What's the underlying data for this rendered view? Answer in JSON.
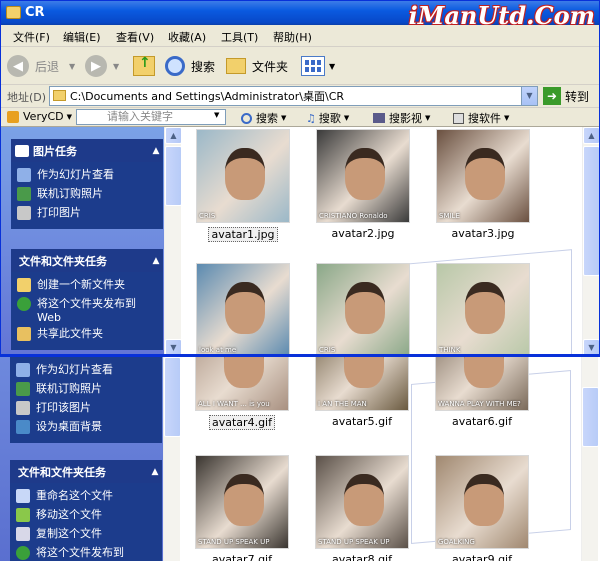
{
  "window": {
    "title": "CR",
    "brand": "iManUtd.Com"
  },
  "menu": [
    {
      "label": "文件(F)"
    },
    {
      "label": "编辑(E)"
    },
    {
      "label": "查看(V)"
    },
    {
      "label": "收藏(A)"
    },
    {
      "label": "工具(T)"
    },
    {
      "label": "帮助(H)"
    }
  ],
  "toolbar": {
    "back": "后退",
    "search": "搜索",
    "folders": "文件夹"
  },
  "address": {
    "label": "地址(D)",
    "path": "C:\\Documents and Settings\\Administrator\\桌面\\CR",
    "go": "转到"
  },
  "verycd": {
    "name": "VeryCD",
    "placeholder": "请输入关键字",
    "search": "搜索",
    "songs": "搜歌",
    "videos": "搜影视",
    "software": "搜软件"
  },
  "panels": {
    "picture_tasks": {
      "title": "图片任务",
      "items": [
        "作为幻灯片查看",
        "联机订购照片",
        "打印图片"
      ]
    },
    "file_tasks": {
      "title": "文件和文件夹任务",
      "items": [
        "创建一个新文件夹",
        "将这个文件夹发布到 Web",
        "共享此文件夹"
      ]
    }
  },
  "panels2": {
    "picture_tasks": {
      "items": [
        "作为幻灯片查看",
        "联机订购照片",
        "打印该图片",
        "设为桌面背景"
      ]
    },
    "file_tasks": {
      "title": "文件和文件夹任务",
      "items": [
        "重命名这个文件",
        "移动这个文件",
        "复制这个文件",
        "将这个文件发布到"
      ]
    }
  },
  "files": [
    {
      "name": "avatar1.jpg",
      "overlay": "CRIS",
      "color": "#9bb8c8"
    },
    {
      "name": "avatar2.jpg",
      "overlay": "CRISTIANO Ronaldo",
      "color": "#3a3a3a"
    },
    {
      "name": "avatar3.jpg",
      "overlay": "SMILE",
      "color": "#6a5040"
    },
    {
      "name": "avatar4.gif",
      "overlay": "look at me",
      "color": "#5b8ab0"
    },
    {
      "name": "avatar5.gif",
      "overlay": "CRIS",
      "color": "#8aa888"
    },
    {
      "name": "avatar6.gif",
      "overlay": "THINK",
      "color": "#b8c8a8"
    },
    {
      "name": "avatar4.gif",
      "overlay": "ALL I WANT ... is you",
      "color": "#a89080"
    },
    {
      "name": "avatar5.gif",
      "overlay": "I AN THE MAN",
      "color": "#6a5a40"
    },
    {
      "name": "avatar6.gif",
      "overlay": "WANNA PLAY WITH ME?",
      "color": "#7a6a5a"
    },
    {
      "name": "avatar7.gif",
      "overlay": "STAND UP SPEAK UP",
      "color": "#3a3530"
    },
    {
      "name": "avatar8.gif",
      "overlay": "STAND UP SPEAK UP",
      "color": "#5a5048"
    },
    {
      "name": "avatar9.gif",
      "overlay": "GOALKING",
      "color": "#a08870"
    }
  ]
}
